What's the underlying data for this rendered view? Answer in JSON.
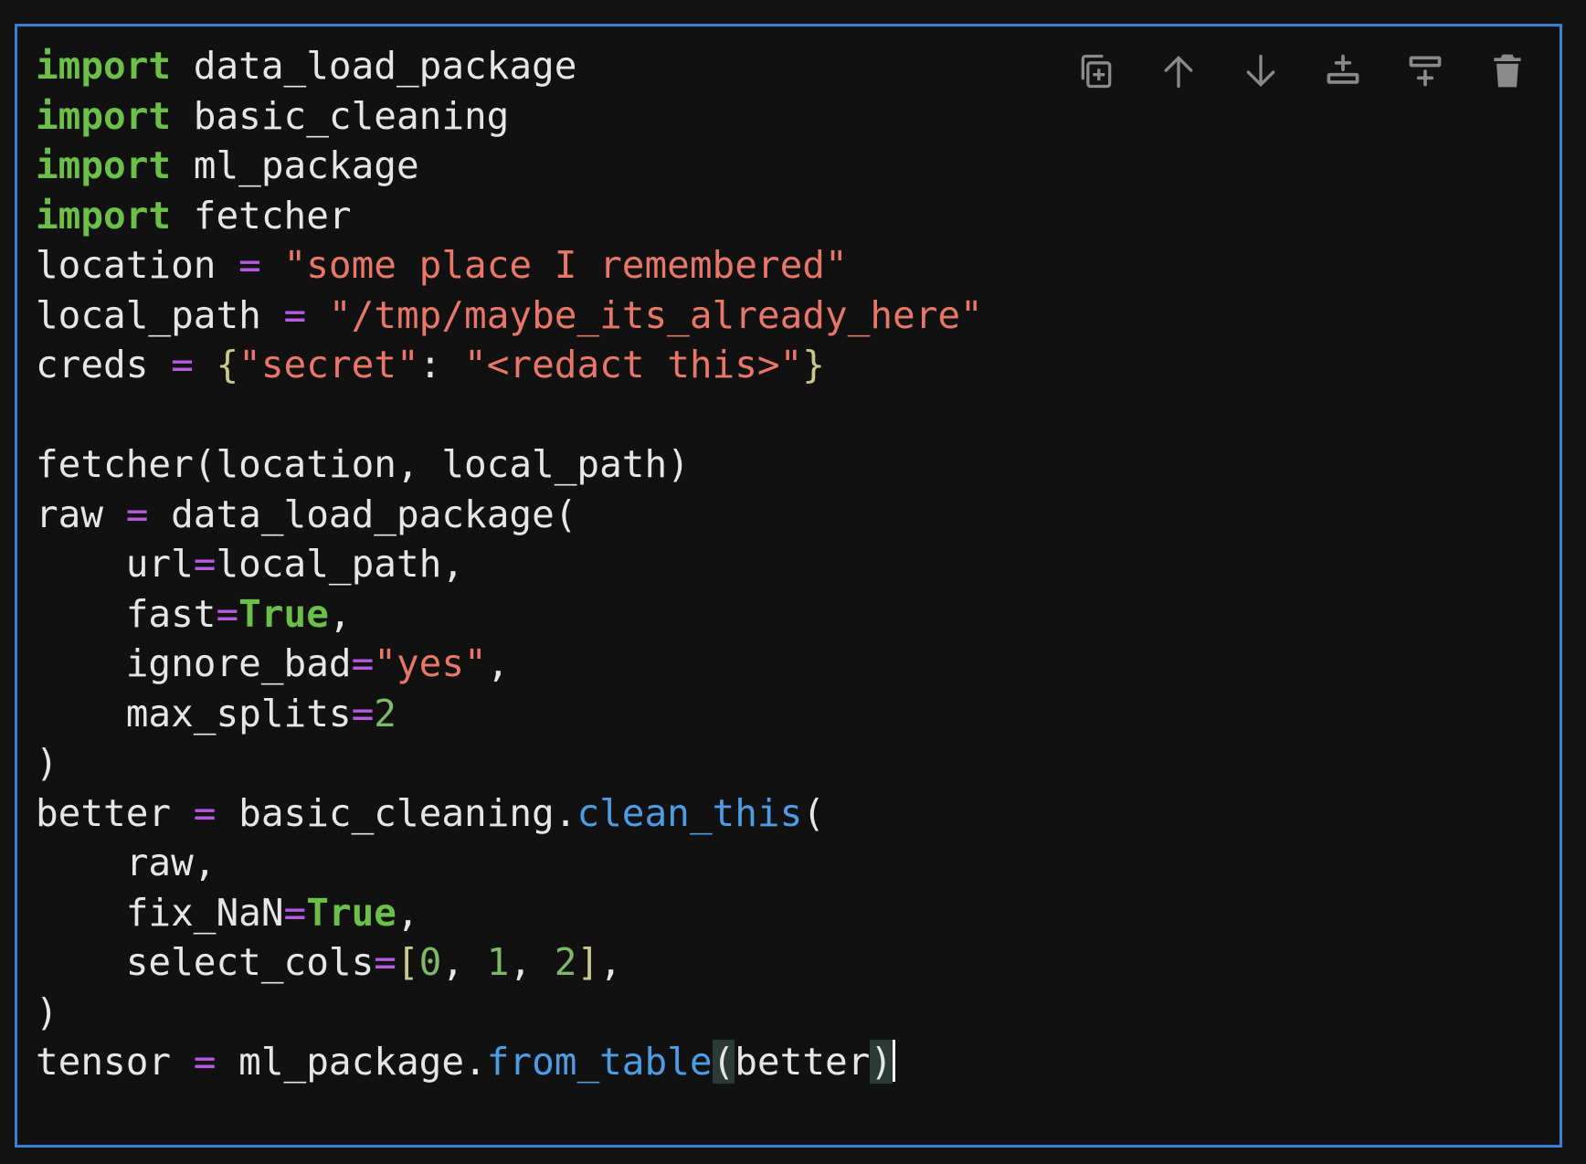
{
  "toolbar": {
    "buttons": [
      {
        "name": "duplicate-cell-button",
        "icon": "duplicate-icon"
      },
      {
        "name": "move-up-button",
        "icon": "arrow-up-icon"
      },
      {
        "name": "move-down-button",
        "icon": "arrow-down-icon"
      },
      {
        "name": "insert-cell-above-button",
        "icon": "insert-above-icon"
      },
      {
        "name": "insert-cell-below-button",
        "icon": "insert-below-icon"
      },
      {
        "name": "delete-cell-button",
        "icon": "trash-icon"
      }
    ],
    "icon_color": "#8a8a8a"
  },
  "colors": {
    "cell_border": "#3a7fd4",
    "keyword": "#6cc04a",
    "operator": "#b55be0",
    "string": "#e8776a",
    "number": "#7fb86b",
    "function": "#4d9de6",
    "text": "#e6e6e6"
  },
  "code_lines": [
    [
      {
        "t": "kw",
        "v": "import"
      },
      {
        "t": "tx",
        "v": " data_load_package"
      }
    ],
    [
      {
        "t": "kw",
        "v": "import"
      },
      {
        "t": "tx",
        "v": " basic_cleaning"
      }
    ],
    [
      {
        "t": "kw",
        "v": "import"
      },
      {
        "t": "tx",
        "v": " ml_package"
      }
    ],
    [
      {
        "t": "kw",
        "v": "import"
      },
      {
        "t": "tx",
        "v": " fetcher"
      }
    ],
    [
      {
        "t": "tx",
        "v": "location "
      },
      {
        "t": "op",
        "v": "="
      },
      {
        "t": "tx",
        "v": " "
      },
      {
        "t": "str",
        "v": "\"some place I remembered\""
      }
    ],
    [
      {
        "t": "tx",
        "v": "local_path "
      },
      {
        "t": "op",
        "v": "="
      },
      {
        "t": "tx",
        "v": " "
      },
      {
        "t": "str",
        "v": "\"/tmp/maybe_its_already_here\""
      }
    ],
    [
      {
        "t": "tx",
        "v": "creds "
      },
      {
        "t": "op",
        "v": "="
      },
      {
        "t": "tx",
        "v": " "
      },
      {
        "t": "br",
        "v": "{"
      },
      {
        "t": "str",
        "v": "\"secret\""
      },
      {
        "t": "tx",
        "v": ": "
      },
      {
        "t": "str",
        "v": "\"<redact this>\""
      },
      {
        "t": "br",
        "v": "}"
      }
    ],
    [],
    [
      {
        "t": "tx",
        "v": "fetcher(location, local_path)"
      }
    ],
    [
      {
        "t": "tx",
        "v": "raw "
      },
      {
        "t": "op",
        "v": "="
      },
      {
        "t": "tx",
        "v": " data_load_package("
      }
    ],
    [
      {
        "t": "tx",
        "v": "    url"
      },
      {
        "t": "op",
        "v": "="
      },
      {
        "t": "tx",
        "v": "local_path,"
      }
    ],
    [
      {
        "t": "tx",
        "v": "    fast"
      },
      {
        "t": "op",
        "v": "="
      },
      {
        "t": "kw",
        "v": "True"
      },
      {
        "t": "tx",
        "v": ","
      }
    ],
    [
      {
        "t": "tx",
        "v": "    ignore_bad"
      },
      {
        "t": "op",
        "v": "="
      },
      {
        "t": "str",
        "v": "\"yes\""
      },
      {
        "t": "tx",
        "v": ","
      }
    ],
    [
      {
        "t": "tx",
        "v": "    max_splits"
      },
      {
        "t": "op",
        "v": "="
      },
      {
        "t": "num",
        "v": "2"
      }
    ],
    [
      {
        "t": "tx",
        "v": ")"
      }
    ],
    [
      {
        "t": "tx",
        "v": "better "
      },
      {
        "t": "op",
        "v": "="
      },
      {
        "t": "tx",
        "v": " basic_cleaning."
      },
      {
        "t": "fn",
        "v": "clean_this"
      },
      {
        "t": "tx",
        "v": "("
      }
    ],
    [
      {
        "t": "tx",
        "v": "    raw,"
      }
    ],
    [
      {
        "t": "tx",
        "v": "    fix_NaN"
      },
      {
        "t": "op",
        "v": "="
      },
      {
        "t": "kw",
        "v": "True"
      },
      {
        "t": "tx",
        "v": ","
      }
    ],
    [
      {
        "t": "tx",
        "v": "    select_cols"
      },
      {
        "t": "op",
        "v": "="
      },
      {
        "t": "br",
        "v": "["
      },
      {
        "t": "num",
        "v": "0"
      },
      {
        "t": "tx",
        "v": ", "
      },
      {
        "t": "num",
        "v": "1"
      },
      {
        "t": "tx",
        "v": ", "
      },
      {
        "t": "num",
        "v": "2"
      },
      {
        "t": "br",
        "v": "]"
      },
      {
        "t": "tx",
        "v": ","
      }
    ],
    [
      {
        "t": "tx",
        "v": ")"
      }
    ],
    [
      {
        "t": "tx",
        "v": "tensor "
      },
      {
        "t": "op",
        "v": "="
      },
      {
        "t": "tx",
        "v": " ml_package."
      },
      {
        "t": "fn",
        "v": "from_table"
      },
      {
        "t": "match",
        "v": "("
      },
      {
        "t": "tx",
        "v": "better"
      },
      {
        "t": "match",
        "v": ")"
      },
      {
        "t": "cursor",
        "v": ""
      }
    ]
  ]
}
